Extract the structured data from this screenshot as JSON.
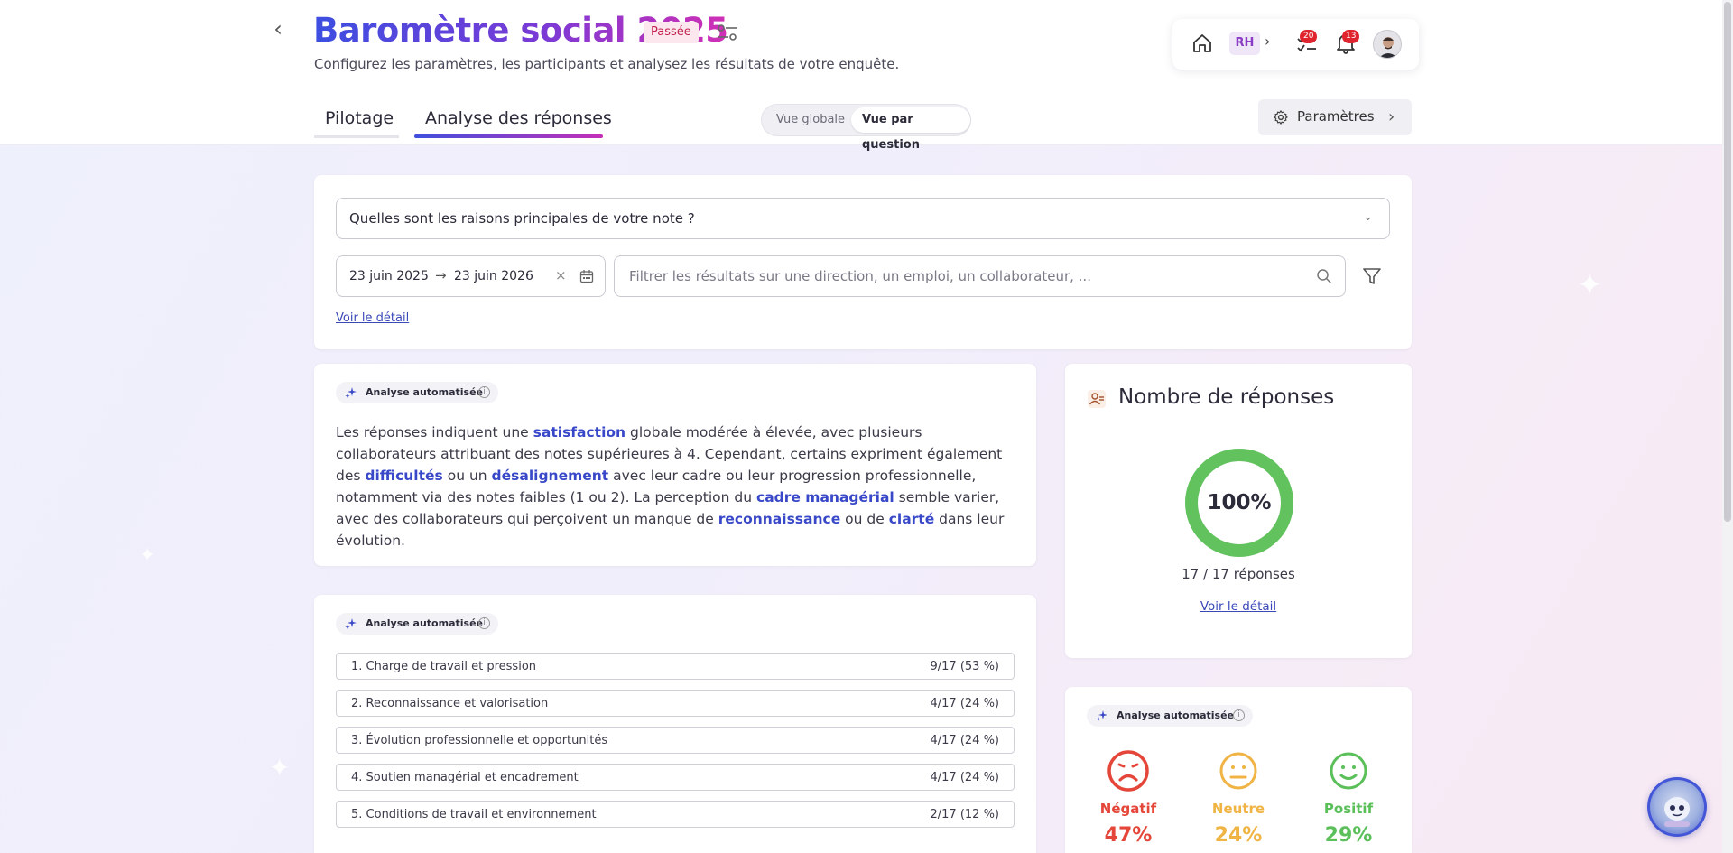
{
  "header": {
    "title": "Baromètre social 2025",
    "status": "Passée",
    "subtitle": "Configurez les paramètres, les participants et analysez les résultats de votre enquête.",
    "tabs": [
      {
        "label": "Pilotage",
        "active": false
      },
      {
        "label": "Analyse des réponses",
        "active": true
      }
    ],
    "view_toggle": {
      "global": "Vue globale",
      "question": "Vue par question",
      "selected": "Vue par question"
    },
    "params_label": "Paramètres"
  },
  "toolbar": {
    "role_badge": "RH",
    "tasks_count": "20",
    "notifications_count": "13"
  },
  "filters": {
    "question": "Quelles sont les raisons principales de votre note ?",
    "date_start": "23 juin 2025",
    "date_end": "23 juin 2026",
    "search_placeholder": "Filtrer les résultats sur une direction, un emploi, un collaborateur, ...",
    "detail_link": "Voir le détail"
  },
  "ai_label": "Analyse automatisée",
  "summary": {
    "parts": [
      {
        "t": "Les réponses indiquent une ",
        "k": false
      },
      {
        "t": "satisfaction",
        "k": true
      },
      {
        "t": " globale modérée à élevée, avec plusieurs collaborateurs attribuant des notes supérieures à 4. Cependant, certains expriment également des ",
        "k": false
      },
      {
        "t": "difficultés",
        "k": true
      },
      {
        "t": " ou un ",
        "k": false
      },
      {
        "t": "désalignement",
        "k": true
      },
      {
        "t": " avec leur cadre ou leur progression professionnelle, notamment via des notes faibles (1 ou 2). La perception du ",
        "k": false
      },
      {
        "t": "cadre managérial",
        "k": true
      },
      {
        "t": " semble varier, avec des collaborateurs qui perçoivent un manque de ",
        "k": false
      },
      {
        "t": "reconnaissance",
        "k": true
      },
      {
        "t": " ou de ",
        "k": false
      },
      {
        "t": "clarté",
        "k": true
      },
      {
        "t": " dans leur évolution.",
        "k": false
      }
    ]
  },
  "themes": [
    {
      "label": "1. Charge de travail et pression",
      "value": "9/17 (53 %)"
    },
    {
      "label": "2. Reconnaissance et valorisation",
      "value": "4/17 (24 %)"
    },
    {
      "label": "3. Évolution professionnelle et opportunités",
      "value": "4/17 (24 %)"
    },
    {
      "label": "4. Soutien managérial et encadrement",
      "value": "4/17 (24 %)"
    },
    {
      "label": "5. Conditions de travail et environnement",
      "value": "2/17 (12 %)"
    }
  ],
  "responses": {
    "title": "Nombre de réponses",
    "percent_label": "100%",
    "rate": 1.0,
    "count_text": "17 / 17 réponses",
    "detail_link": "Voir le détail",
    "ring_color": "#62c35e"
  },
  "sentiment": [
    {
      "label": "Négatif",
      "pct": "47%",
      "color": "#e4463a",
      "icon": "sad-face-icon"
    },
    {
      "label": "Neutre",
      "pct": "24%",
      "color": "#f0b445",
      "icon": "neutral-face-icon"
    },
    {
      "label": "Positif",
      "pct": "29%",
      "color": "#5bbf5a",
      "icon": "happy-face-icon"
    }
  ]
}
